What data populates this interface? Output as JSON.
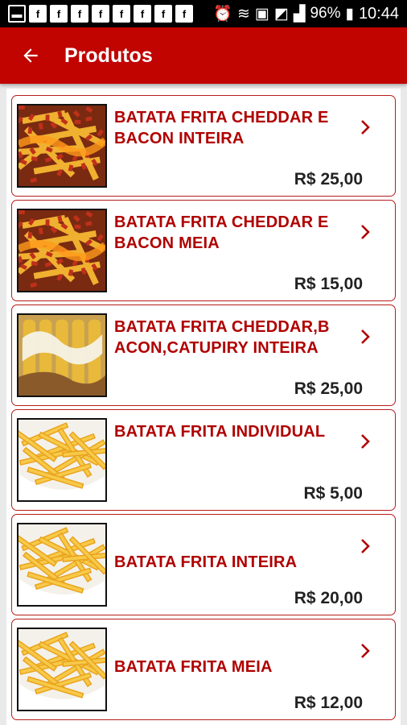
{
  "status_bar": {
    "battery": "96%",
    "time": "10:44"
  },
  "app_bar": {
    "title": "Produtos",
    "back_icon": "arrow-left-icon"
  },
  "products": [
    {
      "name": "BATATA FRITA CHEDDAR E BACON INTEIRA",
      "price": "R$ 25,00",
      "image": "cheddar-bacon-fries"
    },
    {
      "name": "BATATA FRITA CHEDDAR E BACON MEIA",
      "price": "R$ 15,00",
      "image": "cheddar-bacon-fries"
    },
    {
      "name": "BATATA FRITA CHEDDAR,BACON,CATUPIRY INTEIRA",
      "price": "R$ 25,00",
      "image": "catupiry-fries"
    },
    {
      "name": "BATATA FRITA INDIVIDUAL",
      "price": "R$ 5,00",
      "image": "plain-fries"
    },
    {
      "name": "BATATA FRITA INTEIRA",
      "price": "R$ 20,00",
      "image": "plain-fries"
    },
    {
      "name": "BATATA FRITA MEIA",
      "price": "R$ 12,00",
      "image": "plain-fries"
    }
  ],
  "colors": {
    "primary": "#c10400",
    "product_name": "#b00000",
    "card_border": "#b71c1c"
  }
}
